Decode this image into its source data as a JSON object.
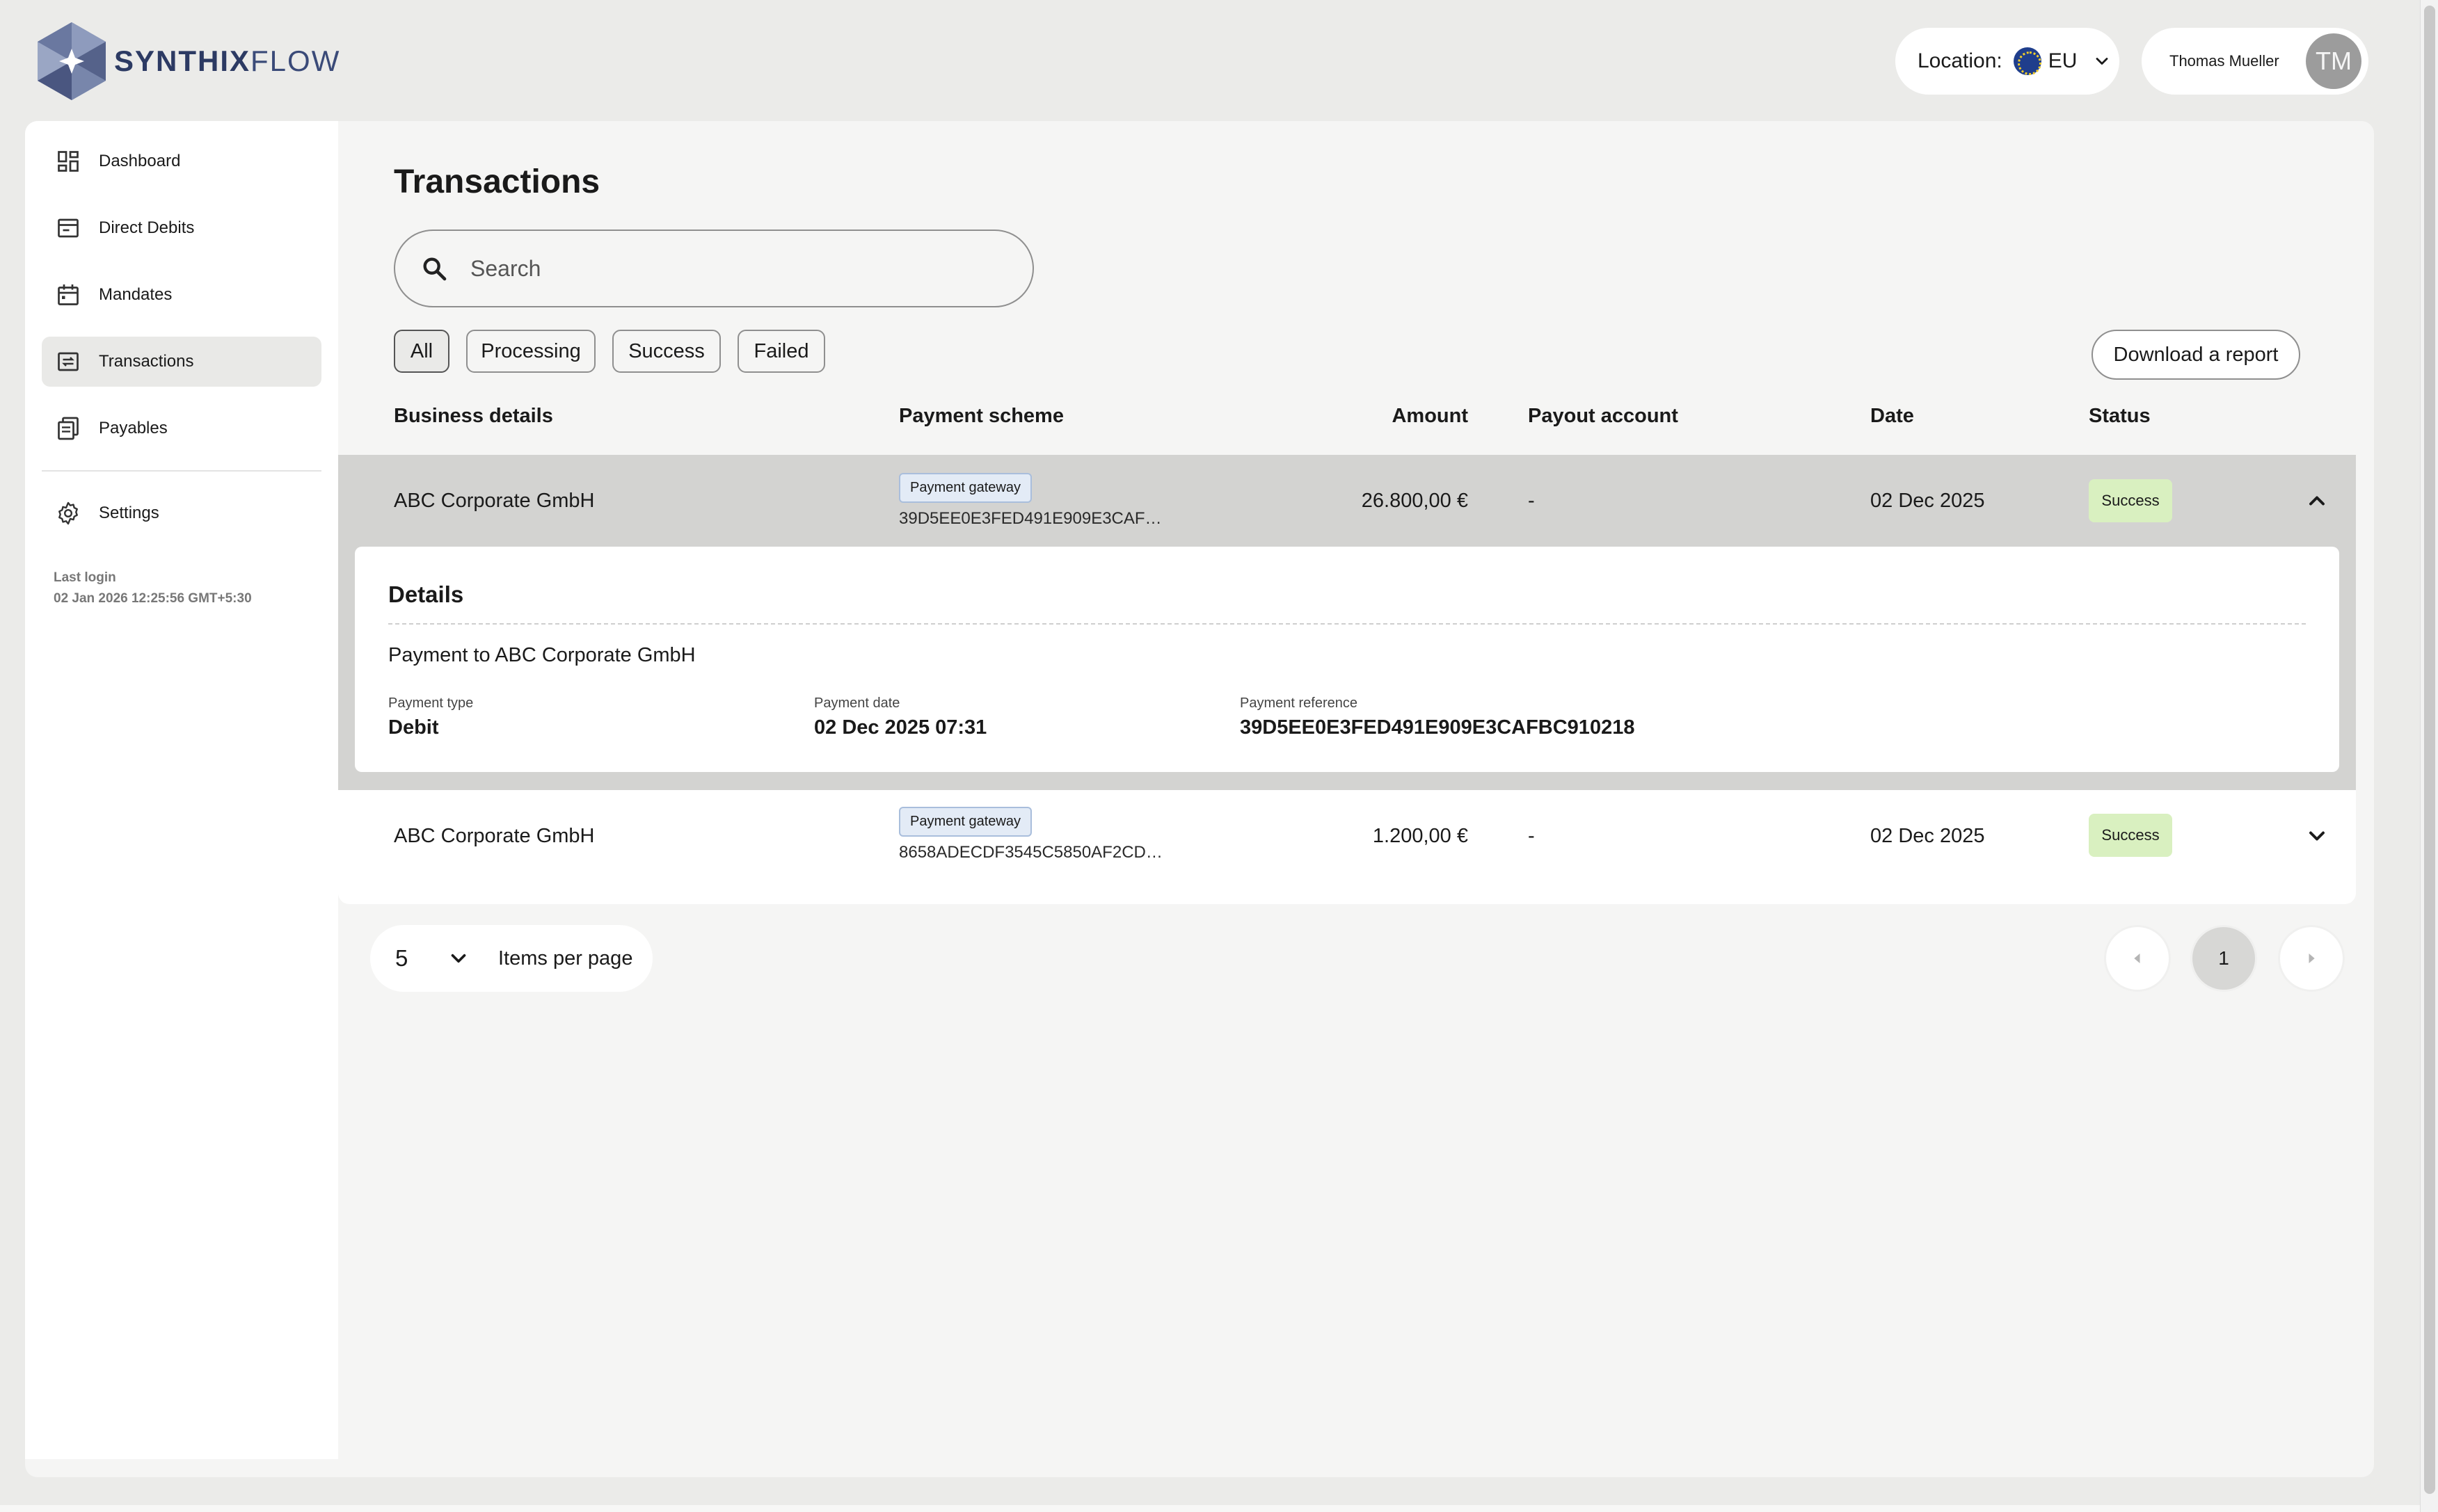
{
  "brand": {
    "name_bold": "SYNTHIX",
    "name_light": "FLOW"
  },
  "header": {
    "location_label": "Location:",
    "location_value": "EU",
    "user_name": "Thomas Mueller",
    "avatar_initials": "TM"
  },
  "sidebar": {
    "items": [
      {
        "label": "Dashboard",
        "icon": "dashboard-icon"
      },
      {
        "label": "Direct Debits",
        "icon": "direct-debits-icon"
      },
      {
        "label": "Mandates",
        "icon": "calendar-icon"
      },
      {
        "label": "Transactions",
        "icon": "transactions-icon",
        "active": true
      },
      {
        "label": "Payables",
        "icon": "payables-icon"
      }
    ],
    "settings_label": "Settings",
    "last_login_label": "Last login",
    "last_login_value": "02 Jan 2026 12:25:56 GMT+5:30"
  },
  "page": {
    "title": "Transactions",
    "search_placeholder": "Search",
    "filters": [
      "All",
      "Processing",
      "Success",
      "Failed"
    ],
    "active_filter": "All",
    "download_label": "Download a report"
  },
  "table": {
    "headers": {
      "business": "Business details",
      "scheme": "Payment scheme",
      "amount": "Amount",
      "payout": "Payout account",
      "date": "Date",
      "status": "Status"
    },
    "rows": [
      {
        "business": "ABC Corporate GmbH",
        "scheme_tag": "Payment gateway",
        "scheme_ref": "39D5EE0E3FED491E909E3CAF…",
        "amount": "26.800,00 €",
        "payout": "-",
        "date": "02 Dec 2025",
        "status": "Success",
        "expanded": true
      },
      {
        "business": "ABC Corporate GmbH",
        "scheme_tag": "Payment gateway",
        "scheme_ref": "8658ADECDF3545C5850AF2CD…",
        "amount": "1.200,00 €",
        "payout": "-",
        "date": "02 Dec 2025",
        "status": "Success",
        "expanded": false
      }
    ],
    "details": {
      "title": "Details",
      "description": "Payment to ABC Corporate GmbH",
      "payment_type_label": "Payment type",
      "payment_type_value": "Debit",
      "payment_date_label": "Payment date",
      "payment_date_value": "02 Dec 2025 07:31",
      "payment_reference_label": "Payment reference",
      "payment_reference_value": "39D5EE0E3FED491E909E3CAFBC910218"
    }
  },
  "pagination": {
    "items_per_page_value": "5",
    "items_per_page_label": "Items per page",
    "current_page": "1"
  },
  "colors": {
    "brand_navy": "#2c3a63",
    "success_badge": "#d9f0c0",
    "tag_bg": "#e3ebf6",
    "expanded_row": "#d3d3d1"
  }
}
